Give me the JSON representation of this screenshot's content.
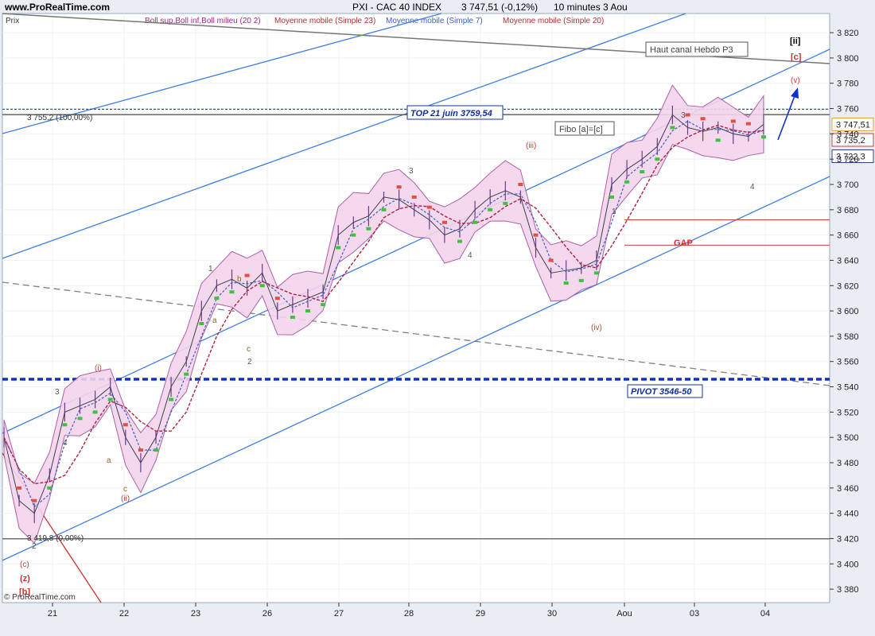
{
  "header": {
    "site": "www.ProRealTime.com",
    "title": "PXI - CAC 40 INDEX",
    "last": "3 747,51 (-0,12%)",
    "interval": "10 minutes  3 Aou"
  },
  "footer": {
    "copyright": "© ProRealTime.com"
  },
  "legend": [
    {
      "label": "Prix",
      "color": "#333333"
    },
    {
      "label": "Boll sup,Boll inf,Boll milieu (20 2)",
      "color": "#9a2b8a"
    },
    {
      "label": "Moyenne mobile (Simple 23)",
      "color": "#b03030"
    },
    {
      "label": "Moyenne mobile (Simple 7)",
      "color": "#4060c0"
    },
    {
      "label": "Moyenne mobile (Simple 20)",
      "color": "#b03030"
    }
  ],
  "chart_data": {
    "type": "line",
    "title": "PXI - CAC 40 INDEX",
    "ylim": [
      3370,
      3830
    ],
    "y_ticks": [
      3380,
      3400,
      3420,
      3440,
      3460,
      3480,
      3500,
      3520,
      3540,
      3560,
      3580,
      3600,
      3620,
      3640,
      3660,
      3680,
      3700,
      3720,
      3740,
      3760,
      3780,
      3800,
      3820
    ],
    "x_ticks": [
      "21",
      "22",
      "23",
      "26",
      "27",
      "28",
      "29",
      "30",
      "Aou",
      "03",
      "04"
    ],
    "series": [
      {
        "name": "Prix",
        "values": [
          3500,
          3450,
          3440,
          3470,
          3520,
          3525,
          3530,
          3540,
          3500,
          3480,
          3500,
          3540,
          3560,
          3600,
          3620,
          3625,
          3618,
          3630,
          3600,
          3605,
          3610,
          3615,
          3660,
          3670,
          3675,
          3690,
          3688,
          3680,
          3672,
          3660,
          3665,
          3680,
          3690,
          3695,
          3690,
          3650,
          3630,
          3632,
          3634,
          3640,
          3700,
          3712,
          3720,
          3730,
          3755,
          3745,
          3742,
          3745,
          3740,
          3738,
          3747.51
        ]
      }
    ],
    "price_labels": [
      {
        "text": "3 747,51",
        "value": 3747.51,
        "color": "#e8a020"
      },
      {
        "text": "3 735,2",
        "value": 3735.2,
        "color": "#c04040"
      },
      {
        "text": "3 722,3",
        "value": 3722.3,
        "color": "#304080"
      }
    ],
    "levels": [
      {
        "name": "fibo-100",
        "label": "3 755,2 (100,00%)",
        "value": 3755.2
      },
      {
        "name": "fibo-0",
        "label": "3 419,8 (0,00%)",
        "value": 3419.8
      },
      {
        "name": "top",
        "label": "TOP 21 juin 3759,54",
        "value": 3759.5
      },
      {
        "name": "pivot",
        "label": "PIVOT 3546-50",
        "value": 3546
      },
      {
        "name": "gap-top",
        "value": 3672
      },
      {
        "name": "gap-bottom",
        "value": 3652
      }
    ],
    "annotations": [
      "Haut canal Hebdo P3",
      "Fibo [a]=[c]",
      "GAP",
      "[ii]",
      "[c]",
      "(v)",
      "(iii)",
      "(iv)",
      "(ii)",
      "(i)",
      "(c)",
      "(z)",
      "[b]",
      "1",
      "2",
      "3",
      "4",
      "a",
      "b",
      "c"
    ]
  }
}
